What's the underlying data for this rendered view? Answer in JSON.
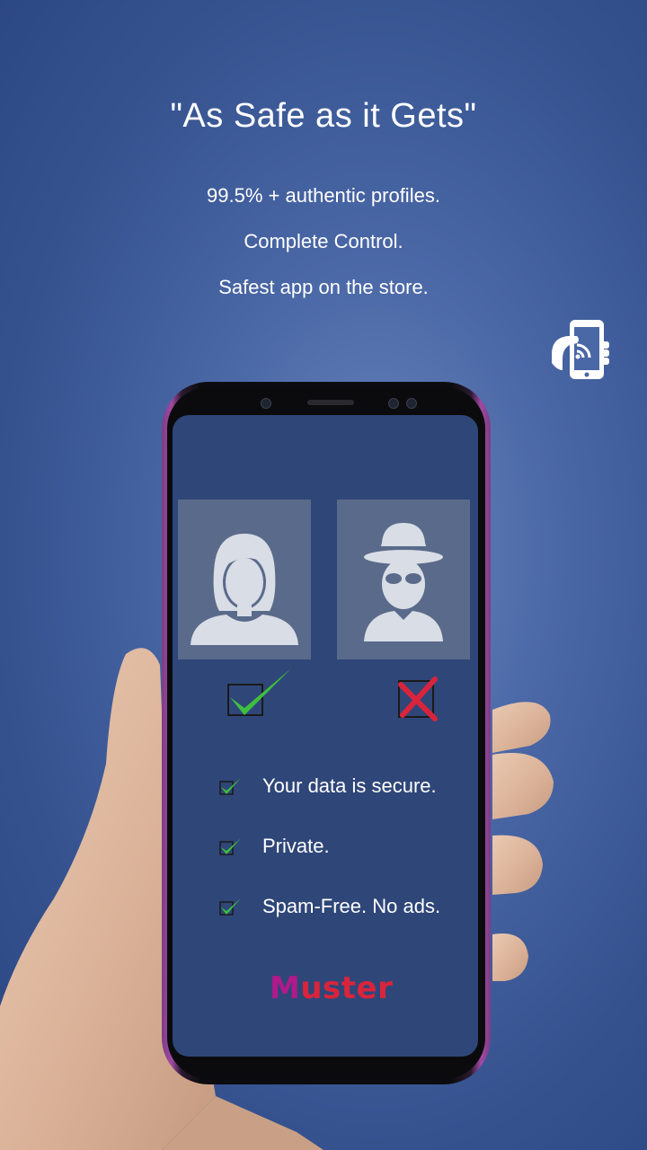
{
  "headline": "\"As Safe as it Gets\"",
  "subtitles": [
    "99.5% + authentic profiles.",
    "Complete Control.",
    "Safest app on the store."
  ],
  "features": [
    "Your data is secure.",
    "Private.",
    "Spam-Free.  No ads."
  ],
  "logo": {
    "first": "M",
    "rest": "uster"
  },
  "icons": [
    "phone-hand-icon",
    "female-avatar-icon",
    "spy-avatar-icon",
    "green-check-icon",
    "red-cross-icon"
  ],
  "colors": {
    "check": "#3fbf3f",
    "cross": "#d9243c",
    "screen": "#2f4678",
    "phone_accent": "#a04aa3"
  }
}
